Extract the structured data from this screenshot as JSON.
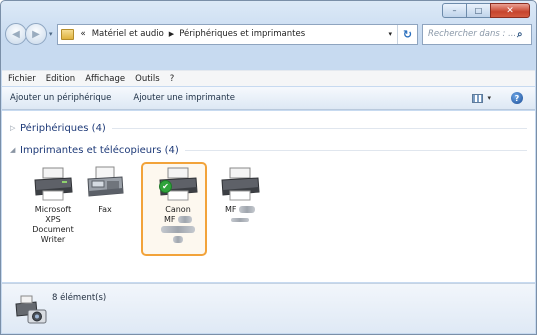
{
  "window": {
    "caption_minimize": "–",
    "caption_maximize": "□",
    "caption_close": "✕"
  },
  "nav": {
    "back_icon": "back-arrow-icon",
    "forward_icon": "forward-arrow-icon",
    "breadcrumb_prefix": "«",
    "crumb_1": "Matériel et audio",
    "crumb_sep": "▶",
    "crumb_2": "Périphériques et imprimantes",
    "dropdown": "▾",
    "refresh_glyph": "↻",
    "search_placeholder": "Rechercher dans : ...",
    "search_glyph": "⌕"
  },
  "menu": {
    "items": [
      "Fichier",
      "Edition",
      "Affichage",
      "Outils",
      "?"
    ]
  },
  "commands": {
    "add_device": "Ajouter un périphérique",
    "add_printer": "Ajouter une imprimante",
    "view_dropdown": "▾",
    "help_glyph": "?"
  },
  "groups": {
    "devices_arrow": "▷",
    "devices_label": "Périphériques (4)",
    "printers_arrow": "◢",
    "printers_label": "Imprimantes et télécopieurs (4)"
  },
  "printers": [
    {
      "line1": "Microsoft",
      "line2": "XPS",
      "line3": "Document",
      "line4": "Writer"
    },
    {
      "line1": "Fax"
    },
    {
      "line1": "Canon",
      "line2": "MF",
      "default_badge": "✔"
    },
    {
      "line1": "MF"
    }
  ],
  "footer": {
    "count": "8 élément(s)"
  },
  "colors": {
    "selection": "#f2a33a",
    "group_text": "#1e3a78",
    "default_check": "#2fa33b"
  }
}
